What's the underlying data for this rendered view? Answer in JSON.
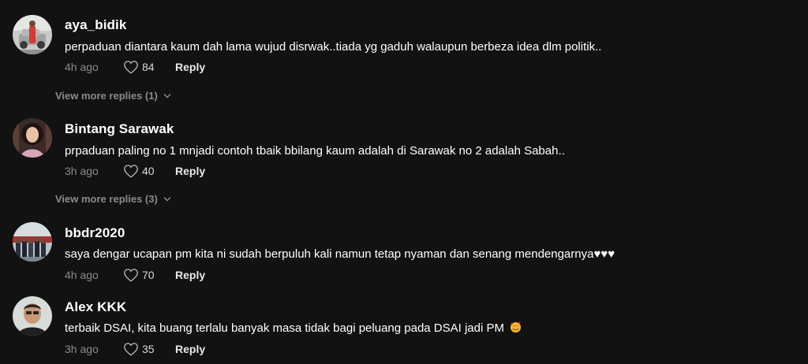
{
  "comments": [
    {
      "username": "aya_bidik",
      "text": "perpaduan diantara kaum dah lama wujud disrwak..tiada yg gaduh walaupun berbeza idea dlm politik..",
      "time": "4h ago",
      "likes": "84",
      "reply_label": "Reply",
      "view_more": "View more replies (1)"
    },
    {
      "username": "Bintang Sarawak",
      "text": "prpaduan paling no 1 mnjadi contoh tbaik bbilang kaum adalah di Sarawak no 2 adalah Sabah..",
      "time": "3h ago",
      "likes": "40",
      "reply_label": "Reply",
      "view_more": "View more replies (3)"
    },
    {
      "username": "bbdr2020",
      "text": "saya dengar ucapan pm kita ni sudah berpuluh kali namun tetap nyaman dan senang mendengarnya♥♥♥",
      "time": "4h ago",
      "likes": "70",
      "reply_label": "Reply"
    },
    {
      "username": "Alex KKK",
      "text": "terbaik DSAI, kita buang terlalu banyak masa tidak bagi peluang pada DSAI jadi PM",
      "time": "3h ago",
      "likes": "35",
      "reply_label": "Reply"
    }
  ],
  "icons": {
    "like": "heart-outline-icon",
    "expand": "chevron-down-icon",
    "emoji": "smiling-face-with-hearts-icon"
  },
  "colors": {
    "background": "#121212",
    "username": "#ffffff",
    "meta": "#8a8a8a"
  }
}
